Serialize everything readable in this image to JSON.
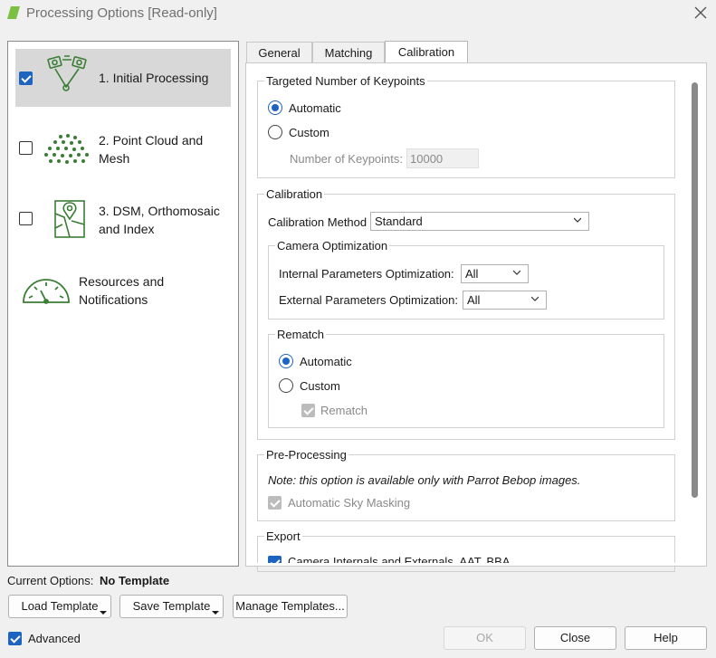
{
  "window": {
    "title": "Processing Options [Read-only]"
  },
  "nav": {
    "items": [
      {
        "label": "1. Initial Processing",
        "checked": true,
        "selected": true
      },
      {
        "label": "2. Point Cloud and\nMesh",
        "checked": false
      },
      {
        "label": "3. DSM, Orthomosaic\nand Index",
        "checked": false
      },
      {
        "label": "Resources and\nNotifications"
      }
    ]
  },
  "tabs": [
    {
      "label": "General",
      "active": false
    },
    {
      "label": "Matching",
      "active": false
    },
    {
      "label": "Calibration",
      "active": true
    }
  ],
  "keypoints": {
    "title": "Targeted Number of Keypoints",
    "automatic_label": "Automatic",
    "custom_label": "Custom",
    "number_label": "Number of Keypoints:",
    "number_value": "10000",
    "selected": "automatic"
  },
  "calibration": {
    "title": "Calibration",
    "method_label": "Calibration Method",
    "method_value": "Standard",
    "camera_opt": {
      "title": "Camera Optimization",
      "internal_label": "Internal Parameters Optimization:",
      "internal_value": "All",
      "external_label": "External Parameters Optimization:",
      "external_value": "All"
    },
    "rematch": {
      "title": "Rematch",
      "automatic_label": "Automatic",
      "custom_label": "Custom",
      "rematch_label": "Rematch",
      "selected": "automatic"
    }
  },
  "preprocessing": {
    "title": "Pre-Processing",
    "note": "Note: this option is available only with Parrot Bebop images.",
    "sky_label": "Automatic Sky Masking"
  },
  "export": {
    "title": "Export",
    "item_label": "Camera Internals and Externals, AAT, BBA"
  },
  "footer": {
    "current_label": "Current Options:",
    "current_value": "No Template",
    "load_label": "Load Template",
    "save_label": "Save Template",
    "manage_label": "Manage Templates...",
    "advanced_label": "Advanced",
    "ok_label": "OK",
    "close_label": "Close",
    "help_label": "Help"
  },
  "colors": {
    "accent": "#1d63c0",
    "icon_green": "#3a7d34",
    "app_icon": "#7bc043"
  }
}
